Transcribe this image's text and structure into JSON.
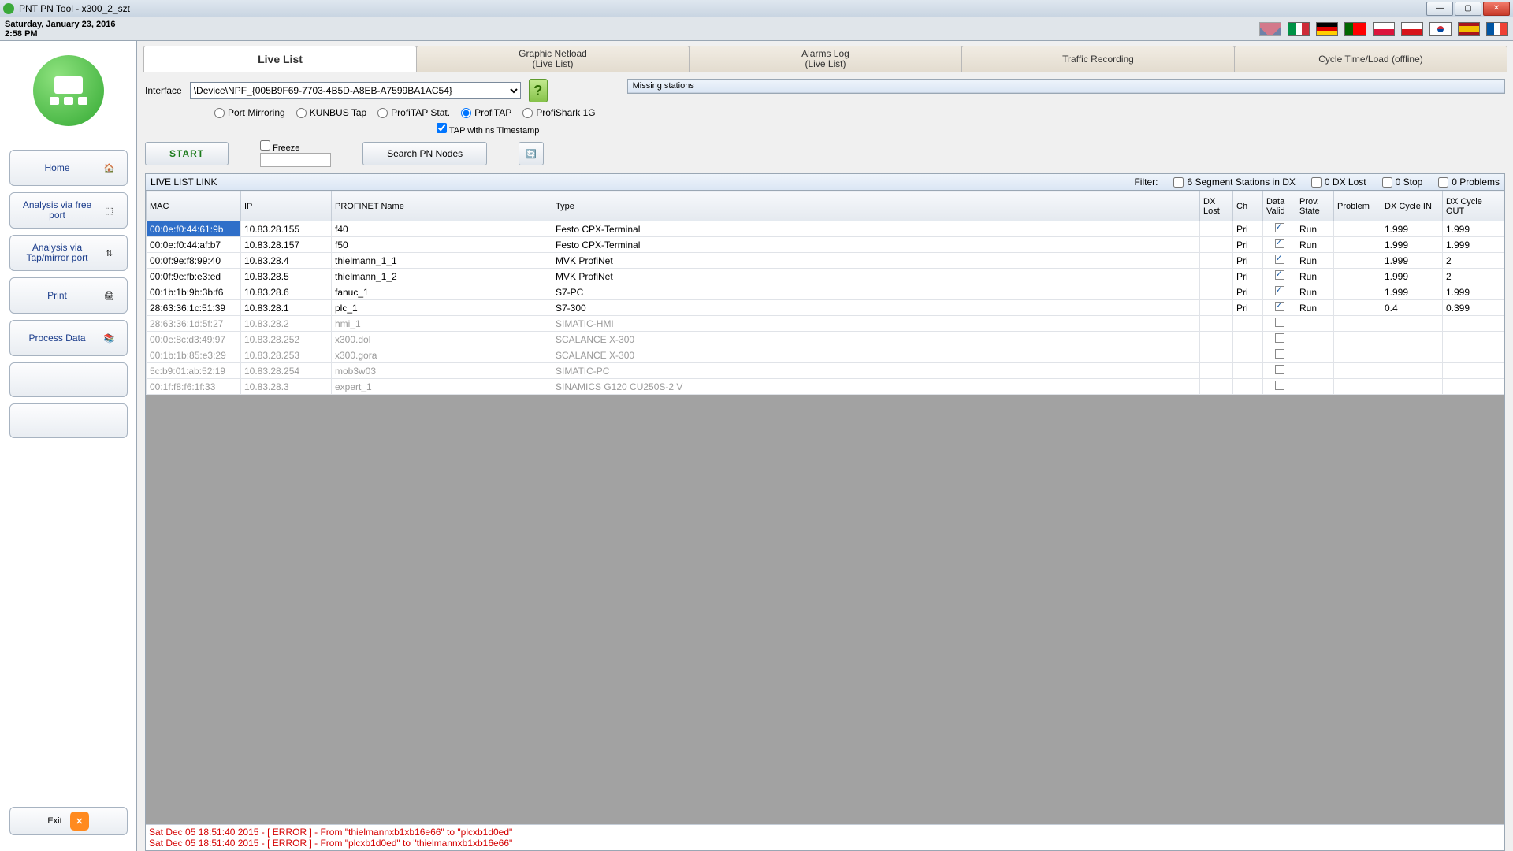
{
  "window": {
    "title": "PNT PN Tool - x300_2_szt"
  },
  "datebar": {
    "date": "Saturday, January 23, 2016",
    "time": "2:58 PM"
  },
  "sidebar": {
    "home": "Home",
    "analysis_free": "Analysis via free port",
    "analysis_tap": "Analysis via Tap/mirror port",
    "print": "Print",
    "process_data": "Process Data",
    "exit": "Exit"
  },
  "tabs": {
    "live": "Live List",
    "netload_l1": "Graphic Netload",
    "netload_l2": "(Live List)",
    "alarms_l1": "Alarms Log",
    "alarms_l2": "(Live List)",
    "traffic": "Traffic Recording",
    "cycle": "Cycle Time/Load (offline)"
  },
  "toolbar": {
    "interface_label": "Interface",
    "interface_value": "\\Device\\NPF_{005B9F69-7703-4B5D-A8EB-A7599BA1AC54}",
    "opt_port": "Port Mirroring",
    "opt_kunbus": "KUNBUS Tap",
    "opt_profitap_stat": "ProfiTAP Stat.",
    "opt_profitap": "ProfiTAP",
    "opt_profishark": "ProfiShark 1G",
    "tap_ns": "TAP with ns Timestamp",
    "start": "START",
    "freeze": "Freeze",
    "search": "Search PN Nodes",
    "missing": "Missing stations"
  },
  "listhdr": {
    "title": "LIVE LIST LINK",
    "filter": "Filter:",
    "f1": "6 Segment Stations in DX",
    "f2": "0 DX Lost",
    "f3": "0 Stop",
    "f4": "0 Problems"
  },
  "cols": {
    "mac": "MAC",
    "ip": "IP",
    "name": "PROFINET Name",
    "type": "Type",
    "dxlost": "DX Lost",
    "ch": "Ch",
    "valid": "Data Valid",
    "prov": "Prov. State",
    "problem": "Problem",
    "cin": "DX Cycle IN",
    "cout": "DX Cycle OUT"
  },
  "rows": [
    {
      "mac": "00:0e:f0:44:61:9b",
      "ip": "10.83.28.155",
      "name": "f40",
      "type": "Festo CPX-Terminal",
      "ch": "Pri",
      "valid": true,
      "prov": "Run",
      "cin": "1.999",
      "cout": "1.999",
      "sel": true,
      "active": true
    },
    {
      "mac": "00:0e:f0:44:af:b7",
      "ip": "10.83.28.157",
      "name": "f50",
      "type": "Festo CPX-Terminal",
      "ch": "Pri",
      "valid": true,
      "prov": "Run",
      "cin": "1.999",
      "cout": "1.999",
      "active": true
    },
    {
      "mac": "00:0f:9e:f8:99:40",
      "ip": "10.83.28.4",
      "name": "thielmann_1_1",
      "type": "MVK ProfiNet",
      "ch": "Pri",
      "valid": true,
      "prov": "Run",
      "cin": "1.999",
      "cout": "2",
      "active": true
    },
    {
      "mac": "00:0f:9e:fb:e3:ed",
      "ip": "10.83.28.5",
      "name": "thielmann_1_2",
      "type": "MVK ProfiNet",
      "ch": "Pri",
      "valid": true,
      "prov": "Run",
      "cin": "1.999",
      "cout": "2",
      "active": true
    },
    {
      "mac": "00:1b:1b:9b:3b:f6",
      "ip": "10.83.28.6",
      "name": "fanuc_1",
      "type": "S7-PC",
      "ch": "Pri",
      "valid": true,
      "prov": "Run",
      "cin": "1.999",
      "cout": "1.999",
      "active": true
    },
    {
      "mac": "28:63:36:1c:51:39",
      "ip": "10.83.28.1",
      "name": "plc_1",
      "type": "S7-300",
      "ch": "Pri",
      "valid": true,
      "prov": "Run",
      "cin": "0.4",
      "cout": "0.399",
      "active": true
    },
    {
      "mac": "28:63:36:1d:5f:27",
      "ip": "10.83.28.2",
      "name": "hmi_1",
      "type": "SIMATIC-HMI",
      "valid": false,
      "active": false
    },
    {
      "mac": "00:0e:8c:d3:49:97",
      "ip": "10.83.28.252",
      "name": "x300.dol",
      "type": "SCALANCE X-300",
      "valid": false,
      "active": false
    },
    {
      "mac": "00:1b:1b:85:e3:29",
      "ip": "10.83.28.253",
      "name": "x300.gora",
      "type": "SCALANCE X-300",
      "valid": false,
      "active": false
    },
    {
      "mac": "5c:b9:01:ab:52:19",
      "ip": "10.83.28.254",
      "name": "mob3w03",
      "type": "SIMATIC-PC",
      "valid": false,
      "active": false
    },
    {
      "mac": "00:1f:f8:f6:1f:33",
      "ip": "10.83.28.3",
      "name": "expert_1",
      "type": "SINAMICS G120 CU250S-2 V",
      "valid": false,
      "active": false
    }
  ],
  "errors": [
    "Sat Dec 05 18:51:40 2015 - [ ERROR ] - From \"thielmannxb1xb16e66\" to \"plcxb1d0ed\"",
    "Sat Dec 05 18:51:40 2015 - [ ERROR ] - From \"plcxb1d0ed\" to \"thielmannxb1xb16e66\""
  ]
}
